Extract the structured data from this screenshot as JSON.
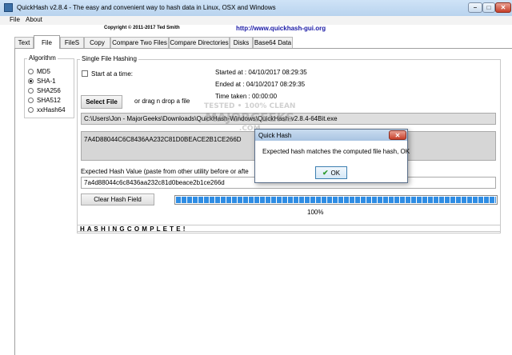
{
  "window": {
    "title": "QuickHash v2.8.4 - The easy and convenient way to hash data in Linux, OSX and Windows",
    "controls": {
      "minimize": "–",
      "maximize": "□",
      "close": "✕"
    }
  },
  "menu": {
    "items": [
      "File",
      "About"
    ]
  },
  "header": {
    "copyright": "Copyright © 2011-2017 Ted Smith",
    "url": "http://www.quickhash-gui.org"
  },
  "tabs": [
    "Text",
    "File",
    "FileS",
    "Copy",
    "Compare Two Files",
    "Compare Directories",
    "Disks",
    "Base64 Data"
  ],
  "active_tab": "File",
  "algorithm": {
    "label": "Algorithm",
    "options": [
      "MD5",
      "SHA-1",
      "SHA256",
      "SHA512",
      "xxHash64"
    ],
    "selected": "SHA-1"
  },
  "single_file": {
    "group_label": "Single File Hashing",
    "start_at_time_label": "Start at a time:",
    "started_at": "Started at : 04/10/2017 08:29:35",
    "ended_at": "Ended at  : 04/10/2017 08:29:35",
    "time_taken": "Time taken : 00:00:00",
    "select_file_label": "Select File",
    "drag_drop_label": "or drag n drop a file",
    "file_path": "C:\\Users\\Jon - MajorGeeks\\Downloads\\QuickHash-Windows\\QuickHash-v2.8.4-64Bit.exe",
    "computed_hash": "7A4D88044C6C8436AA232C81D0BEACE2B1CE266D",
    "expected_label": "Expected Hash Value (paste from utility before or after)",
    "expected_visible": "Expected Hash Value (paste from other utility before or afte",
    "expected_value": "7a4d88044c6c8436aa232c81d0beace2b1ce266d",
    "clear_label": "Clear Hash Field",
    "progress_percent": 100,
    "progress_text": "100%"
  },
  "status": {
    "text": "H A S H I N G   C O M P L E T E !"
  },
  "dialog": {
    "title": "Quick Hash",
    "message": "Expected hash matches the computed file hash, OK",
    "ok_label": "OK"
  },
  "watermark": {
    "line1": "TESTED • 100% CLEAN",
    "line2": "MAJORGEEKS",
    "line3": ".COM"
  },
  "colors": {
    "progress": "#2f8de4",
    "hash_field_bg": "#d6d6d6",
    "url": "#1a1aa6"
  }
}
